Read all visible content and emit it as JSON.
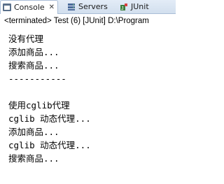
{
  "tabs": [
    {
      "label": "Console",
      "icon": "console-icon",
      "active": true
    },
    {
      "label": "Servers",
      "icon": "servers-icon",
      "active": false
    },
    {
      "label": "JUnit",
      "icon": "junit-icon",
      "active": false
    }
  ],
  "console": {
    "status": "<terminated> Test (6) [JUnit] D:\\Program",
    "lines": [
      "没有代理",
      "添加商品...",
      "搜索商品...",
      "-----------",
      "",
      "使用cglib代理",
      "cglib 动态代理...",
      "添加商品...",
      "cglib 动态代理...",
      "搜索商品..."
    ]
  }
}
